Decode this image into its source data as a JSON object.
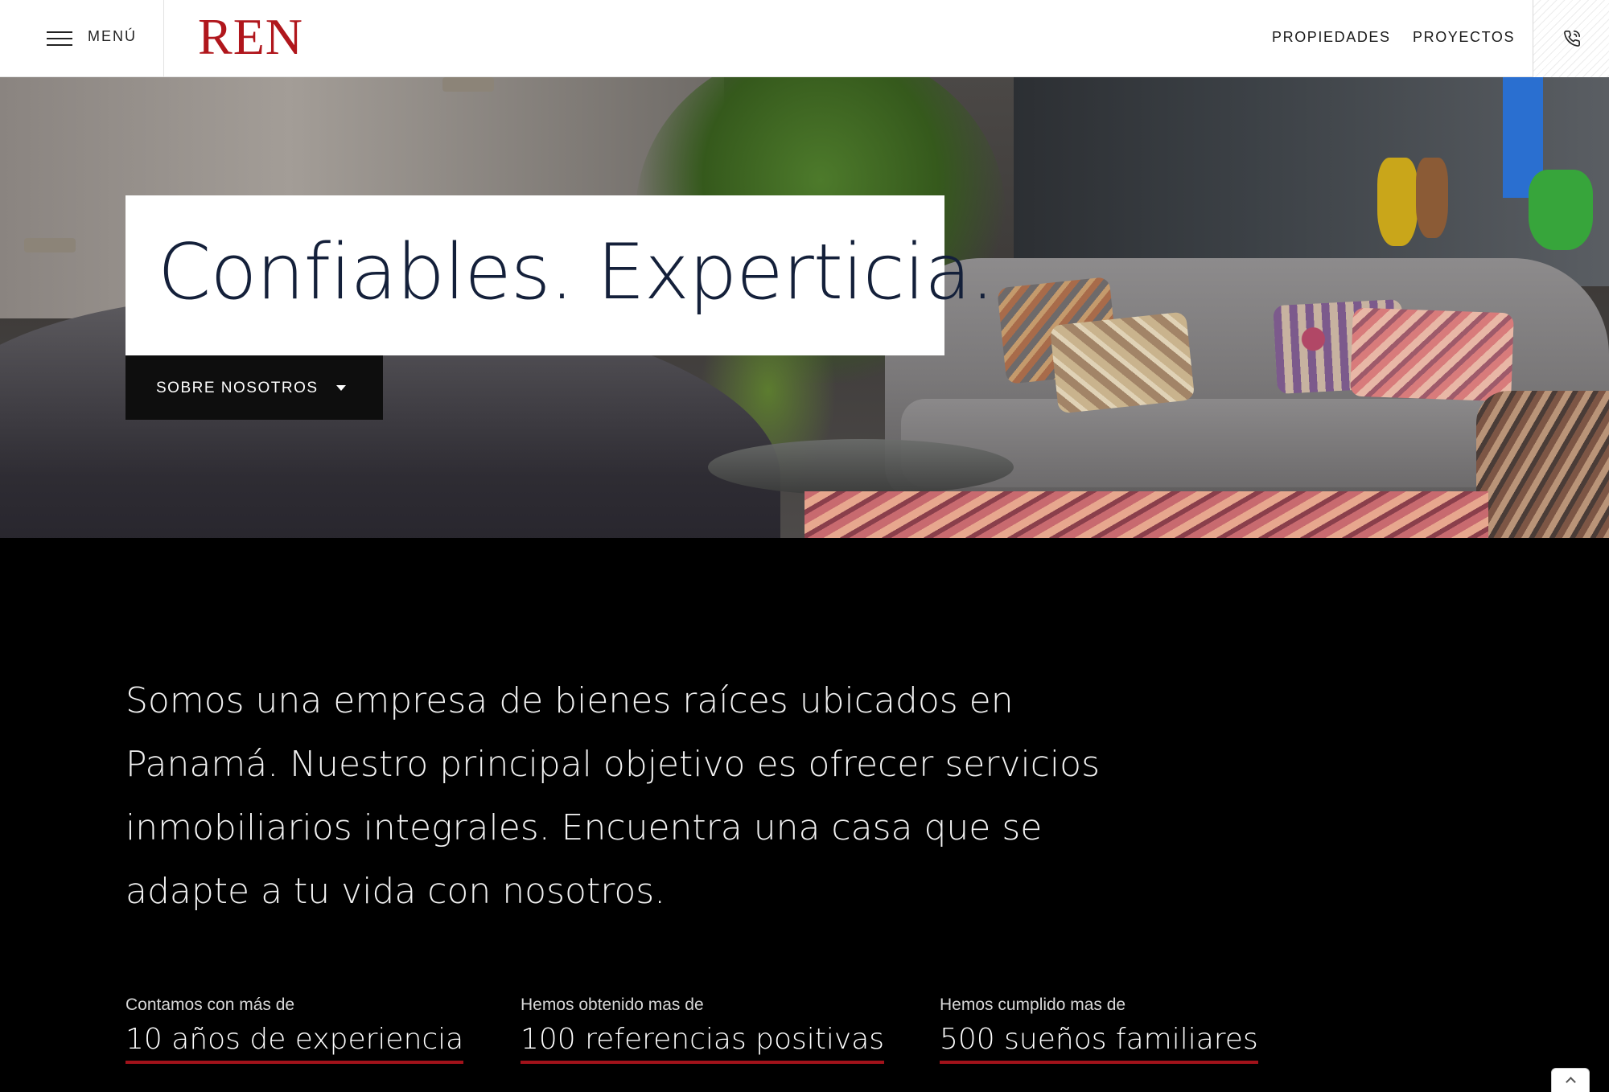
{
  "header": {
    "menu_label": "MENÚ",
    "logo_text": "REN",
    "nav": [
      {
        "label": "PROPIEDADES"
      },
      {
        "label": "PROYECTOS"
      }
    ],
    "phone_icon": "phone-icon",
    "brand_color": "#b0161c"
  },
  "hero": {
    "title": "Confiables. Experticia.",
    "about_button_label": "SOBRE NOSOTROS",
    "about_icon": "caret-down-icon"
  },
  "intro": {
    "text": "Somos una empresa de bienes raíces ubicados en Panamá. Nuestro principal objetivo es ofrecer servicios inmobiliarios integrales. Encuentra una casa que se adapte a tu vida con nosotros."
  },
  "stats": [
    {
      "caption": "Contamos con más de",
      "value": "10 años de experiencia"
    },
    {
      "caption": "Hemos obtenido mas de",
      "value": "100 referencias positivas"
    },
    {
      "caption": "Hemos cumplido mas de",
      "value": "500 sueños familiares"
    }
  ],
  "accent_color": "#a1121a",
  "scroll_top_icon": "chevron-up-icon"
}
